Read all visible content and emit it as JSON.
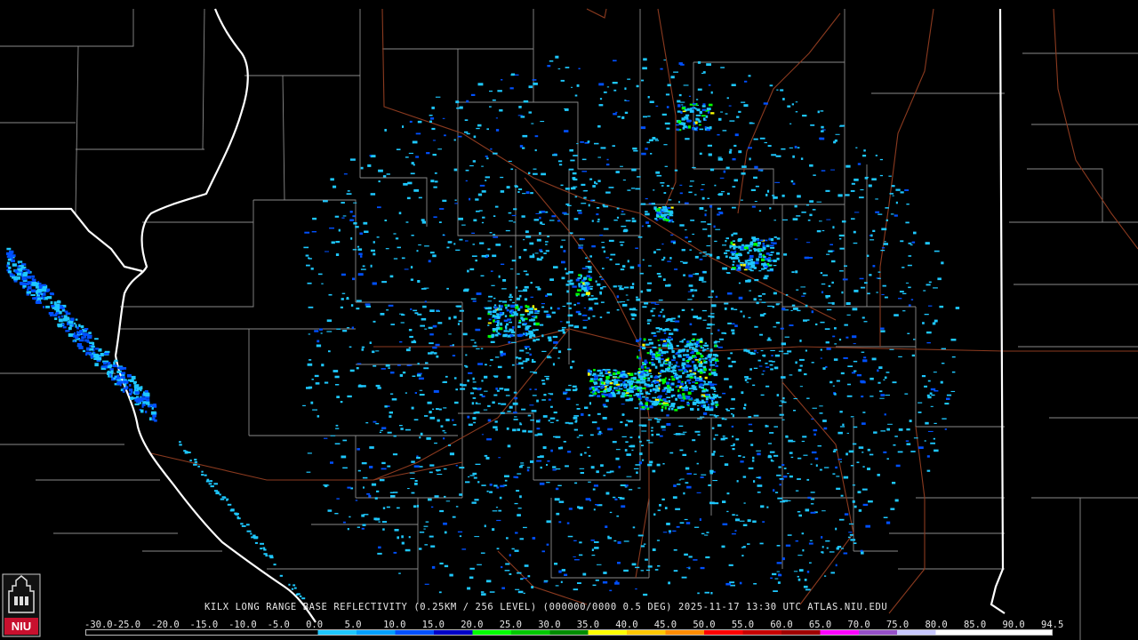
{
  "product": {
    "caption": "KILX LONG RANGE BASE REFLECTIVITY (0.25KM / 256 LEVEL) (000000/0000 0.5 DEG) 2025-11-17 13:30 UTC  ATLAS.NIU.EDU"
  },
  "logo": {
    "text": "NIU"
  },
  "scale": {
    "labels": [
      "-30.0",
      "-25.0",
      "-20.0",
      "-15.0",
      "-10.0",
      "-5.0",
      "0.0",
      "5.0",
      "10.0",
      "15.0",
      "20.0",
      "25.0",
      "30.0",
      "35.0",
      "40.0",
      "45.0",
      "50.0",
      "55.0",
      "60.0",
      "65.0",
      "70.0",
      "75.0",
      "80.0",
      "85.0",
      "90.0",
      "94.5"
    ],
    "colors": [
      "#000000",
      "#000000",
      "#000000",
      "#000000",
      "#000000",
      "#000000",
      "#1ec8ff",
      "#00a0ff",
      "#0050ff",
      "#0000c8",
      "#00ff00",
      "#00c800",
      "#008c00",
      "#ffff00",
      "#ffc800",
      "#ff8c00",
      "#ff0000",
      "#c80000",
      "#a00000",
      "#ff00ff",
      "#9650c8",
      "#c8c8ff",
      "#ffffff",
      "#ffffff",
      "#ffffff"
    ]
  },
  "map_colors": {
    "county": "#8a8a8a",
    "state": "#ffffff",
    "road": "#8b3a1f",
    "weak_echo": "#1ec8ff",
    "moderate_echo": "#0050ff",
    "strong_echo": "#00ff00",
    "heavy_echo": "#ffff00"
  }
}
